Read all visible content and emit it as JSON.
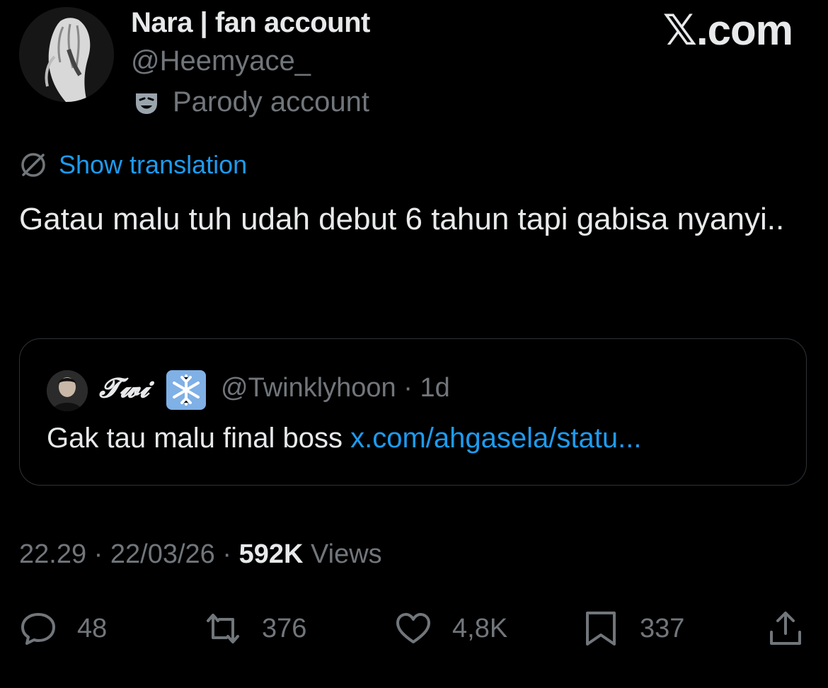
{
  "header": {
    "display_name": "Nara | fan account",
    "handle": "@Heemyace_",
    "label": "Parody account",
    "watermark": "𝕏.com"
  },
  "translation": {
    "label": "Show translation"
  },
  "tweet": {
    "text": "Gatau malu tuh udah debut 6 tahun tapi gabisa nyanyi.."
  },
  "quote": {
    "name": "𝓣𝔀𝓲",
    "name_emoji": "snowflake-icon",
    "handle_time": "@Twinklyhoon · 1d",
    "text": "Gak tau malu final boss ",
    "link": "x.com/ahgasela/statu..."
  },
  "meta": {
    "time_date": "22.29 · 22/03/26 · ",
    "views_count": "592K",
    "views_label": " Views"
  },
  "actions": {
    "replies": "48",
    "reposts": "376",
    "likes": "4,8K",
    "bookmarks": "337"
  },
  "colors": {
    "background": "#000000",
    "text": "#e7e9ea",
    "secondary": "#71767b",
    "link": "#1d9bf0",
    "border": "#2f3336"
  }
}
